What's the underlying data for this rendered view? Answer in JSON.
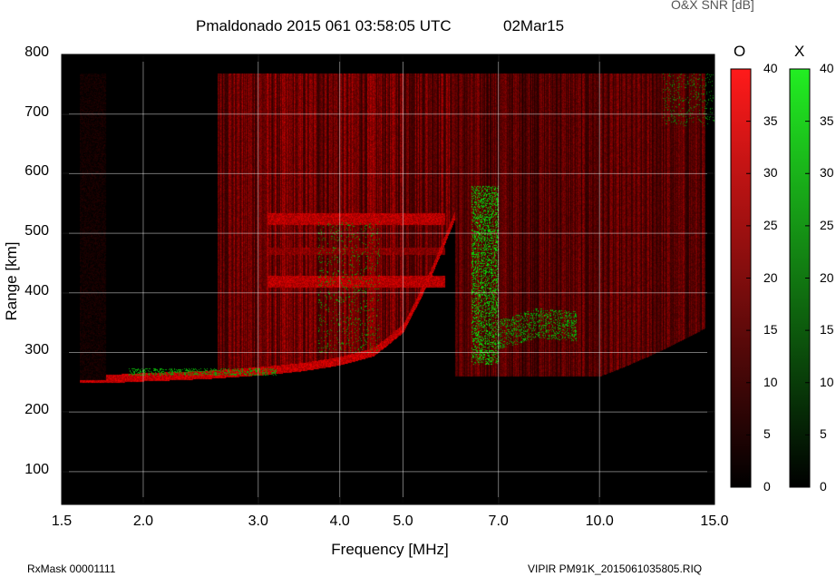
{
  "header": {
    "title": "Pmaldonado 2015 061 03:58:05 UTC",
    "date": "02Mar15",
    "snr_label": "O&X SNR [dB]"
  },
  "footer": {
    "rx_mask": "RxMask 00001111",
    "file": "VIPIR  PM91K_2015061035805.RIQ"
  },
  "chart_data": {
    "type": "heatmap",
    "title": "Pmaldonado 2015 061 03:58:05 UTC",
    "xlabel": "Frequency [MHz]",
    "ylabel": "Range [km]",
    "x_scale": "log",
    "xlim": [
      1.5,
      15.0
    ],
    "ylim": [
      45,
      800
    ],
    "x_ticks": [
      1.5,
      2.0,
      3.0,
      4.0,
      5.0,
      7.0,
      10.0,
      15.0
    ],
    "x_tick_labels": [
      "1.5",
      "2.0",
      "3.0",
      "4.0",
      "5.0",
      "7.0",
      "10.0",
      "15.0"
    ],
    "y_ticks": [
      100,
      200,
      300,
      400,
      500,
      600,
      700,
      800
    ],
    "y_tick_labels": [
      "100",
      "200",
      "300",
      "400",
      "500",
      "600",
      "700",
      "800"
    ],
    "grid": true,
    "data_extent": {
      "x": [
        1.6,
        15.0
      ],
      "y": [
        45,
        768
      ]
    },
    "colorbars": [
      {
        "label": "O",
        "min": 0,
        "max": 40,
        "ticks": [
          0,
          5,
          10,
          15,
          20,
          25,
          30,
          35,
          40
        ],
        "color_high": "#ff1a1a",
        "color_low": "#000000"
      },
      {
        "label": "X",
        "min": 0,
        "max": 40,
        "ticks": [
          0,
          5,
          10,
          15,
          20,
          25,
          30,
          35,
          40
        ],
        "color_high": "#22ee22",
        "color_low": "#000000"
      }
    ],
    "o_trace": {
      "description_points_freq_mhz": [
        1.75,
        2.0,
        2.5,
        3.0,
        3.5,
        4.0,
        4.5,
        5.0,
        5.5,
        6.0
      ],
      "virtual_height_km": [
        255,
        258,
        262,
        268,
        275,
        285,
        300,
        340,
        430,
        530
      ]
    },
    "x_trace": {
      "freq_mhz": [
        2.0,
        3.0,
        4.2,
        6.5,
        7.0,
        8.0,
        9.0
      ],
      "virtual_height_km": [
        265,
        270,
        420,
        300,
        330,
        350,
        345
      ]
    }
  },
  "colors": {
    "background": "#ffffff",
    "plot_bg": "#000000",
    "o_mode": "#ff1a1a",
    "x_mode": "#22ee22",
    "grid": "#ffffff"
  }
}
